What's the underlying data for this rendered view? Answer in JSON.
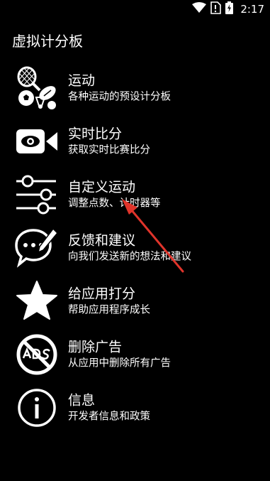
{
  "status_bar": {
    "time": "2:17",
    "icons": [
      "wifi-icon",
      "no-sim-icon",
      "battery-charging-icon"
    ]
  },
  "app_bar": {
    "title": "虚拟计分板"
  },
  "menu": {
    "items": [
      {
        "icon": "sports-balls-icon",
        "title": "运动",
        "subtitle": "各种运动的预设计分板"
      },
      {
        "icon": "video-camera-icon",
        "title": "实时比分",
        "subtitle": "获取实时比赛比分"
      },
      {
        "icon": "sliders-icon",
        "title": "自定义运动",
        "subtitle": "调整点数、计时器等"
      },
      {
        "icon": "chat-edit-icon",
        "title": "反馈和建议",
        "subtitle": "向我们发送新的想法和建议"
      },
      {
        "icon": "star-icon",
        "title": "给应用打分",
        "subtitle": "帮助应用程序成长"
      },
      {
        "icon": "no-ads-icon",
        "title": "删除广告",
        "subtitle": "从应用中删除所有广告"
      },
      {
        "icon": "info-icon",
        "title": "信息",
        "subtitle": "开发者信息和政策"
      }
    ]
  },
  "colors": {
    "background": "#000000",
    "text": "#ffffff",
    "annotation_arrow": "#e0342b"
  }
}
